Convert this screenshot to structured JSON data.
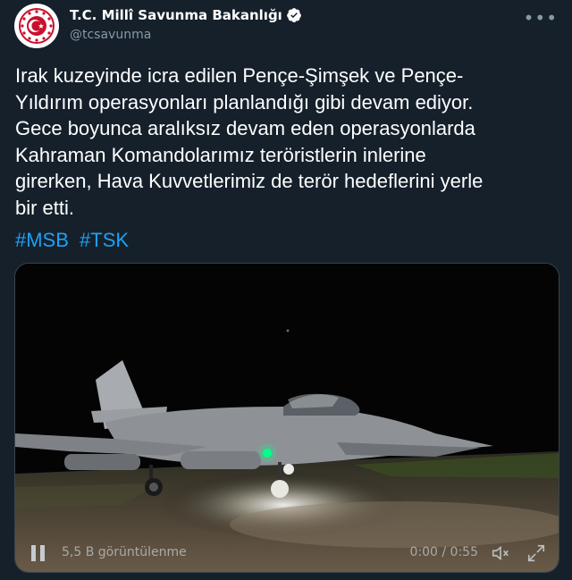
{
  "account": {
    "name": "T.C. Millî Savunma Bakanlığı",
    "handle": "@tcsavunma",
    "avatar_icon": "turkish-military-emblem-icon",
    "verified_icon": "verified-badge-icon",
    "more_icon": "more-options-icon",
    "brand_color": "#c8102e"
  },
  "tweet": {
    "text": "Irak kuzeyinde icra edilen Pençe-Şimşek ve Pençe-\nYıldırım operasyonları planlandığı gibi devam ediyor.\nGece boyunca aralıksız devam eden operasyonlarda\nKahraman Komandolarımız teröristlerin inlerine\ngirerken, Hava Kuvvetlerimiz de terör hedeflerini yerle\nbir etti.",
    "hashtags": [
      "#MSB",
      "#TSK"
    ],
    "link_color": "#1da1f2"
  },
  "video": {
    "views": "5,5 B görüntülenme",
    "time": "0:00 / 0:55",
    "pause_icon": "pause-icon",
    "mute_icon": "muted-speaker-icon",
    "fullscreen_icon": "fullscreen-icon"
  }
}
